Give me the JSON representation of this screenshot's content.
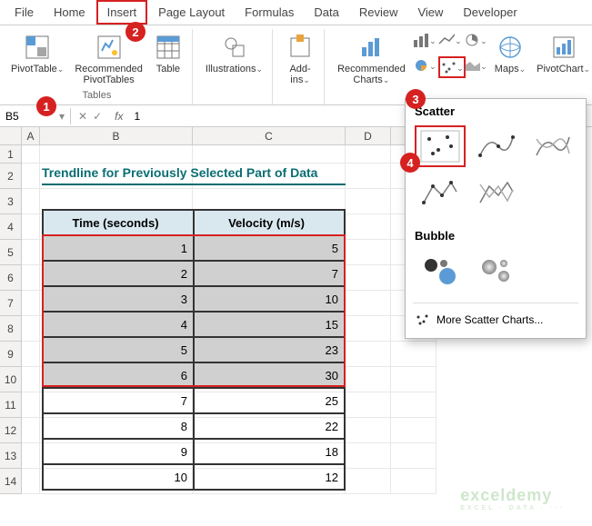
{
  "tabs": [
    "File",
    "Home",
    "Insert",
    "Page Layout",
    "Formulas",
    "Data",
    "Review",
    "View",
    "Developer"
  ],
  "active_tab": "Insert",
  "ribbon": {
    "tables_label": "Tables",
    "pivottable": "PivotTable",
    "recommended_pivot": "Recommended\nPivotTables",
    "table": "Table",
    "illustrations": "Illustrations",
    "addins": "Add-\nins",
    "rec_charts": "Recommended\nCharts",
    "maps": "Maps",
    "pivotchart": "PivotChart"
  },
  "namebox": "B5",
  "formula_value": "1",
  "title": "Trendline for Previously Selected Part of Data",
  "headers": {
    "time": "Time (seconds)",
    "velocity": "Velocity (m/s)"
  },
  "data_rows": [
    {
      "t": "1",
      "v": "5",
      "sel": true
    },
    {
      "t": "2",
      "v": "7",
      "sel": true
    },
    {
      "t": "3",
      "v": "10",
      "sel": true
    },
    {
      "t": "4",
      "v": "15",
      "sel": true
    },
    {
      "t": "5",
      "v": "23",
      "sel": true
    },
    {
      "t": "6",
      "v": "30",
      "sel": true
    },
    {
      "t": "7",
      "v": "25",
      "sel": false
    },
    {
      "t": "8",
      "v": "22",
      "sel": false
    },
    {
      "t": "9",
      "v": "18",
      "sel": false
    },
    {
      "t": "10",
      "v": "12",
      "sel": false
    }
  ],
  "row_numbers": [
    "1",
    "2",
    "3",
    "4",
    "5",
    "6",
    "7",
    "8",
    "9",
    "10",
    "11",
    "12",
    "13",
    "14"
  ],
  "dropdown": {
    "scatter_title": "Scatter",
    "bubble_title": "Bubble",
    "more": "More Scatter Charts..."
  },
  "badges": {
    "b1": "1",
    "b2": "2",
    "b3": "3",
    "b4": "4"
  },
  "watermark": "exceldemy",
  "watermark_sub": "EXCEL · DATA · ···"
}
